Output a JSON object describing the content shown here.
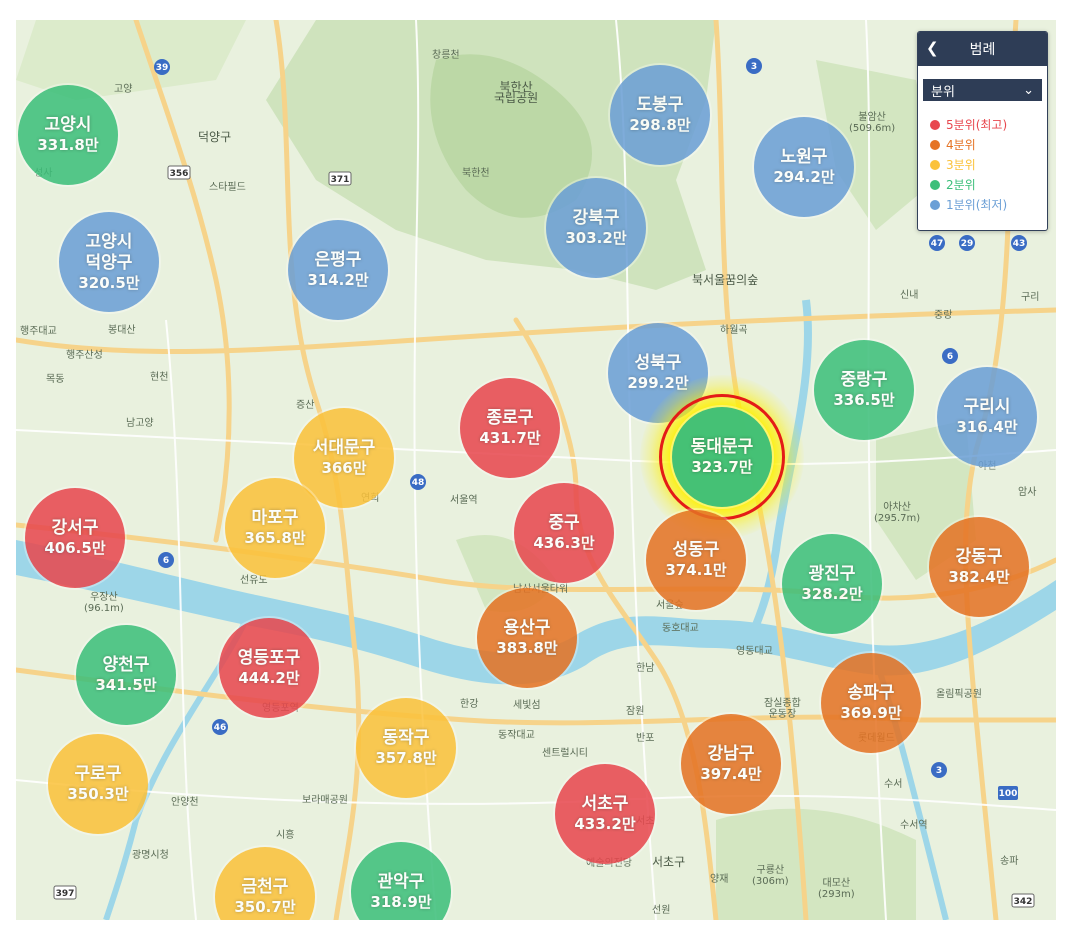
{
  "legend": {
    "title": "범례",
    "back_icon": "chevron-left-icon",
    "selector": {
      "selected": "분위",
      "icon": "chevron-down-icon"
    },
    "items": [
      {
        "label": "5분위(최고)",
        "color": "#e8474e"
      },
      {
        "label": "4분위",
        "color": "#e57324"
      },
      {
        "label": "3분위",
        "color": "#fbc23b"
      },
      {
        "label": "2분위",
        "color": "#3cbf7a"
      },
      {
        "label": "1분위(최저)",
        "color": "#6b9fd6"
      }
    ]
  },
  "highlight": "동대문구",
  "districts": [
    {
      "name": "고양시",
      "value": "331.8만",
      "quintile": 2
    },
    {
      "name": "고양시\n덕양구",
      "value": "320.5만",
      "quintile": 1
    },
    {
      "name": "은평구",
      "value": "314.2만",
      "quintile": 1
    },
    {
      "name": "도봉구",
      "value": "298.8만",
      "quintile": 1
    },
    {
      "name": "노원구",
      "value": "294.2만",
      "quintile": 1
    },
    {
      "name": "강북구",
      "value": "303.2만",
      "quintile": 1
    },
    {
      "name": "성북구",
      "value": "299.2만",
      "quintile": 1
    },
    {
      "name": "중랑구",
      "value": "336.5만",
      "quintile": 2
    },
    {
      "name": "구리시",
      "value": "316.4만",
      "quintile": 1
    },
    {
      "name": "종로구",
      "value": "431.7만",
      "quintile": 5
    },
    {
      "name": "서대문구",
      "value": "366만",
      "quintile": 3
    },
    {
      "name": "동대문구",
      "value": "323.7만",
      "quintile": 2
    },
    {
      "name": "강서구",
      "value": "406.5만",
      "quintile": 5
    },
    {
      "name": "마포구",
      "value": "365.8만",
      "quintile": 3
    },
    {
      "name": "중구",
      "value": "436.3만",
      "quintile": 5
    },
    {
      "name": "성동구",
      "value": "374.1만",
      "quintile": 4
    },
    {
      "name": "광진구",
      "value": "328.2만",
      "quintile": 2
    },
    {
      "name": "강동구",
      "value": "382.4만",
      "quintile": 4
    },
    {
      "name": "용산구",
      "value": "383.8만",
      "quintile": 4
    },
    {
      "name": "양천구",
      "value": "341.5만",
      "quintile": 2
    },
    {
      "name": "영등포구",
      "value": "444.2만",
      "quintile": 5
    },
    {
      "name": "송파구",
      "value": "369.9만",
      "quintile": 4
    },
    {
      "name": "동작구",
      "value": "357.8만",
      "quintile": 3
    },
    {
      "name": "강남구",
      "value": "397.4만",
      "quintile": 4
    },
    {
      "name": "구로구",
      "value": "350.3만",
      "quintile": 3
    },
    {
      "name": "서초구",
      "value": "433.2만",
      "quintile": 5
    },
    {
      "name": "관악구",
      "value": "318.9만",
      "quintile": 2
    },
    {
      "name": "금천구",
      "value": "350.7만",
      "quintile": 3
    }
  ],
  "places": [
    "북한산\n국립공원",
    "북한천",
    "창릉천",
    "덕양구",
    "스타필드",
    "성사",
    "고양",
    "북서울꿈의숲",
    "하월곡",
    "신내",
    "중랑",
    "구리",
    "봉대산",
    "행주산성",
    "행주대교",
    "목동",
    "현천",
    "남고양",
    "증산",
    "연희",
    "서울역",
    "남산서울타워",
    "서울숲",
    "동호대교",
    "영동대교",
    "아차산\n(295.7m)",
    "암사",
    "한남",
    "세빛섬",
    "반포",
    "동작대교",
    "센트럴시티",
    "잠원",
    "서초",
    "서초구",
    "예술의전당",
    "보라매공원",
    "시흥",
    "광명시청",
    "안양천",
    "구룡산\n(306m)",
    "대모산\n(293m)",
    "양재",
    "수서",
    "수서역",
    "송파",
    "잠실종합\n운동장",
    "롯데월드",
    "올림픽공원",
    "불암산\n(509.6m)",
    "한강",
    "선유도",
    "우장산\n(96.1m)",
    "영등포역",
    "아천",
    "선원"
  ]
}
